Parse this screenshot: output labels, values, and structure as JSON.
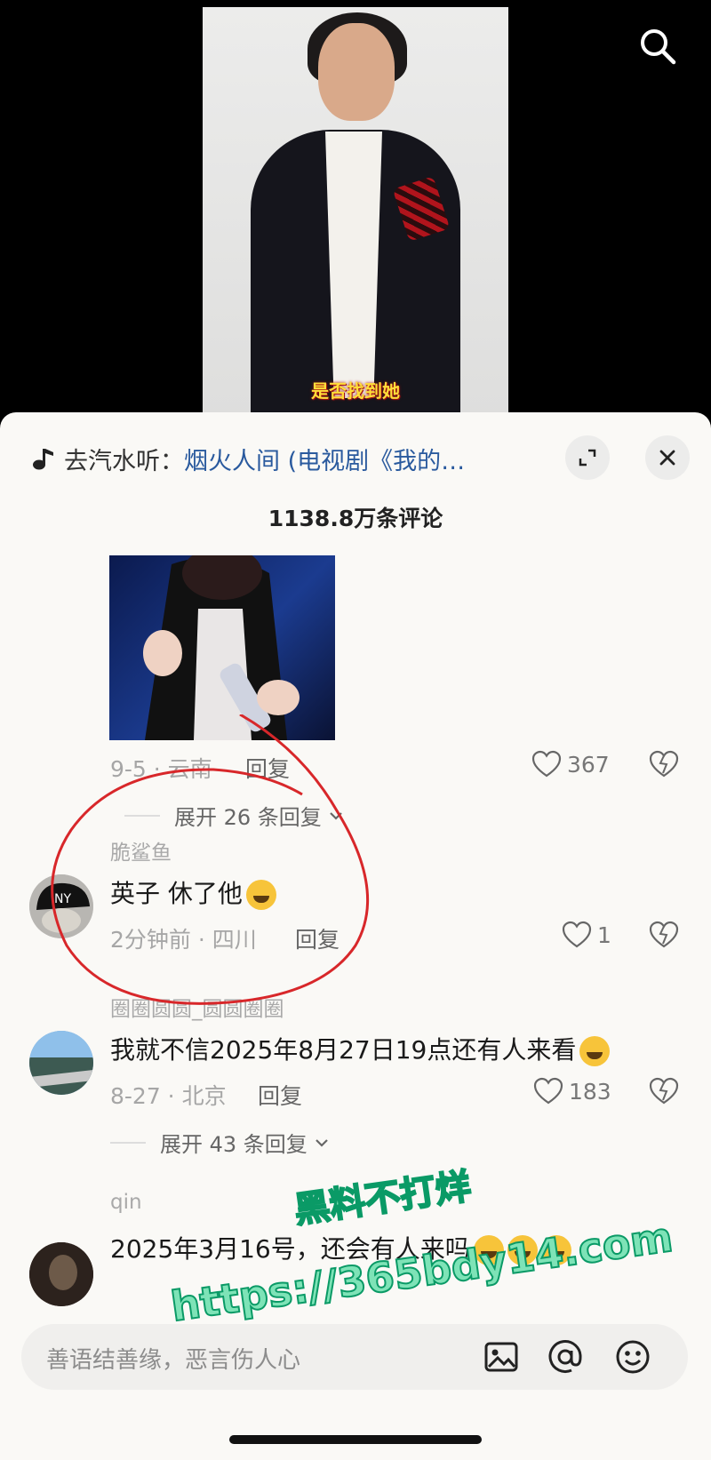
{
  "video": {
    "subtitle": "是否找到她"
  },
  "sheet": {
    "music_prefix": "去汽水听：",
    "music_title": "烟火人间 (电视剧《我的…",
    "comment_count": "1138.8万条评论"
  },
  "comments": [
    {
      "meta": "9-5 · 云南",
      "reply_label": "回复",
      "likes": "367",
      "expand_label": "展开 26 条回复"
    },
    {
      "username": "脆鲨鱼",
      "text": "英子 休了他",
      "meta": "2分钟前 · 四川",
      "reply_label": "回复",
      "likes": "1"
    },
    {
      "username": "圈圈圆圆_圆圆圈圈",
      "text": "我就不信2025年8月27日19点还有人来看",
      "meta": "8-27 · 北京",
      "reply_label": "回复",
      "likes": "183",
      "expand_label": "展开 43 条回复"
    },
    {
      "username": "qin",
      "text": "2025年3月16号，还会有人来吗"
    }
  ],
  "input": {
    "placeholder": "善语结善缘，恶言伤人心"
  },
  "watermark": {
    "line1": "黑料不打烊",
    "line2": "https://365bdy14.com"
  },
  "icons": [
    "search-icon",
    "music-note-icon",
    "expand-icon",
    "close-icon",
    "heart-icon",
    "broken-heart-icon",
    "image-icon",
    "at-icon",
    "emoji-icon",
    "chevron-down-icon"
  ],
  "colors": {
    "accent_link": "#2a5a9e",
    "subtitle": "#ffde3a",
    "watermark": "#7ee3b7",
    "annotation": "#d8272a"
  }
}
